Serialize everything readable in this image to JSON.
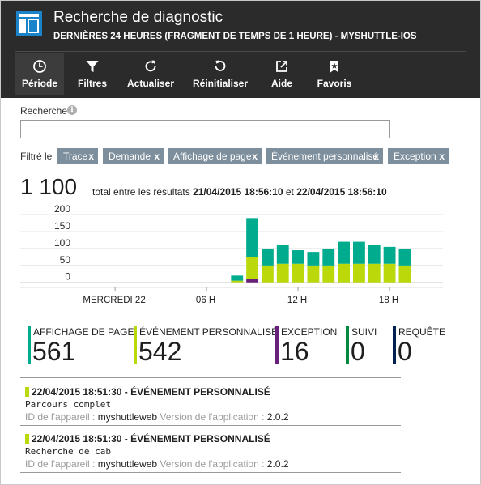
{
  "header": {
    "title": "Recherche de diagnostic",
    "subtitle": "DERNIÈRES 24 HEURES (FRAGMENT DE TEMPS DE 1 HEURE) - MYSHUTTLE-IOS"
  },
  "toolbar": {
    "items": [
      {
        "label": "Période",
        "icon": "clock-icon"
      },
      {
        "label": "Filtres",
        "icon": "funnel-icon"
      },
      {
        "label": "Actualiser",
        "icon": "refresh-icon"
      },
      {
        "label": "Réinitialiser",
        "icon": "undo-icon"
      },
      {
        "label": "Aide",
        "icon": "external-link-icon"
      },
      {
        "label": "Favoris",
        "icon": "bookmark-star-icon"
      }
    ]
  },
  "search": {
    "label": "Recherche",
    "value": "",
    "info": "i"
  },
  "filters": {
    "label": "Filtré le",
    "close": "x",
    "chips": [
      {
        "label": "Trace"
      },
      {
        "label": "Demande"
      },
      {
        "label": "Affichage de page"
      },
      {
        "label": "Événement personnalisé"
      },
      {
        "label": "Exception"
      }
    ]
  },
  "total": {
    "value": "1 100",
    "text_pre": "total entre les résultats",
    "from": "21/04/2015 18:56:10",
    "and": "et",
    "to": "22/04/2015 18:56:10"
  },
  "chart_data": {
    "type": "bar",
    "stacked": true,
    "y_ticks": [
      0,
      50,
      100,
      150,
      200
    ],
    "ylim": [
      -15,
      210
    ],
    "x_tick_labels": [
      {
        "label": "MERCREDI 22",
        "slot": 2
      },
      {
        "label": "06 H",
        "slot": 8
      },
      {
        "label": "12 H",
        "slot": 14
      },
      {
        "label": "18 H",
        "slot": 20
      }
    ],
    "slots": 24,
    "grid": true,
    "colors": {
      "teal": "#00ab8e",
      "lime": "#bad80a",
      "purple": "#68217a"
    },
    "series": [
      {
        "color": "purple",
        "values": [
          0,
          0,
          0,
          0,
          0,
          0,
          0,
          0,
          0,
          0,
          0,
          10,
          0,
          0,
          0,
          0,
          0,
          0,
          0,
          0,
          0,
          0,
          0,
          0
        ]
      },
      {
        "color": "lime",
        "values": [
          0,
          0,
          0,
          0,
          0,
          0,
          0,
          0,
          0,
          0,
          0,
          65,
          0,
          0,
          0,
          0,
          0,
          0,
          0,
          0,
          0,
          0,
          0,
          0
        ]
      },
      {
        "color": "lime",
        "values": [
          0,
          0,
          0,
          0,
          0,
          0,
          0,
          0,
          0,
          0,
          5,
          0,
          0,
          0,
          0,
          0,
          0,
          0,
          0,
          0,
          0,
          0,
          0,
          0
        ]
      },
      {
        "color": "teal",
        "values": [
          0,
          0,
          0,
          0,
          0,
          0,
          0,
          0,
          0,
          0,
          15,
          115,
          0,
          0,
          0,
          0,
          0,
          0,
          0,
          0,
          0,
          0,
          0,
          0
        ]
      },
      {
        "color": "lime",
        "values": [
          0,
          0,
          0,
          0,
          0,
          0,
          0,
          0,
          0,
          0,
          0,
          0,
          50,
          55,
          55,
          50,
          50,
          55,
          55,
          55,
          55,
          50,
          0,
          0
        ]
      },
      {
        "color": "teal",
        "values": [
          0,
          0,
          0,
          0,
          0,
          0,
          0,
          0,
          0,
          0,
          0,
          0,
          50,
          55,
          40,
          40,
          50,
          65,
          65,
          55,
          50,
          50,
          0,
          0
        ]
      }
    ]
  },
  "stats": [
    {
      "label": "AFFICHAGE DE PAGE",
      "value": "561",
      "color": "#00ab8e"
    },
    {
      "label": "ÉVÉNEMENT PERSONNALISÉ",
      "value": "542",
      "color": "#bad80a"
    },
    {
      "label": "EXCEPTION",
      "value": "16",
      "color": "#68217a"
    },
    {
      "label": "SUIVI",
      "value": "0",
      "color": "#00893e"
    },
    {
      "label": "REQUÊTE",
      "value": "0",
      "color": "#002050"
    }
  ],
  "results": [
    {
      "title": "22/04/2015 18:51:30 - ÉVÉNEMENT PERSONNALISÉ",
      "message": "Parcours complet",
      "device_label": "ID de l'appareil :",
      "device_value": "myshuttleweb",
      "version_label": "Version de l'application :",
      "version_value": "2.0.2"
    },
    {
      "title": "22/04/2015 18:51:30 - ÉVÉNEMENT PERSONNALISÉ",
      "message": "Recherche de cab",
      "device_label": "ID de l'appareil :",
      "device_value": "myshuttleweb",
      "version_label": "Version de l'application :",
      "version_value": "2.0.2"
    }
  ]
}
